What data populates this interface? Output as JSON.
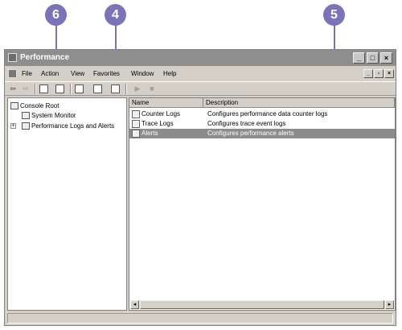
{
  "callouts": [
    "6",
    "4",
    "5"
  ],
  "window": {
    "title": "Performance"
  },
  "menu": [
    "File",
    "Action",
    "View",
    "Favorites",
    "Window",
    "Help"
  ],
  "tree": {
    "root": "Console Root",
    "items": [
      "System Monitor",
      "Performance Logs and Alerts"
    ]
  },
  "list": {
    "columns": [
      "Name",
      "Description"
    ],
    "rows": [
      {
        "name": "Counter Logs",
        "description": "Configures performance data counter logs"
      },
      {
        "name": "Trace Logs",
        "description": "Configures trace event logs"
      },
      {
        "name": "Alerts",
        "description": "Configures performance alerts",
        "selected": true
      }
    ]
  },
  "colors": {
    "callout": "#7b73b9",
    "titlebar": "#8e8e8e",
    "selection": "#8c8c8c",
    "chrome": "#d4d0c8"
  }
}
